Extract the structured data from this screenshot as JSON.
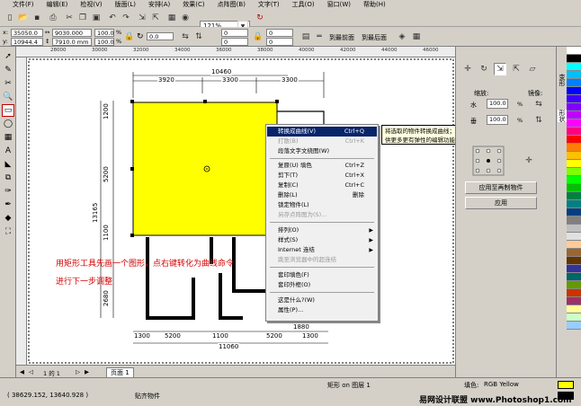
{
  "menubar": {
    "items": [
      "文件(F)",
      "编辑(E)",
      "检视(V)",
      "版面(L)",
      "安排(A)",
      "效果(C)",
      "点阵图(B)",
      "文字(T)",
      "工具(O)",
      "窗口(W)",
      "帮助(H)"
    ]
  },
  "toolbar": {
    "zoom_value": "121%"
  },
  "propbar": {
    "x_label": "x:",
    "x_value": "35050.0",
    "y_label": "y:",
    "y_value": "10944.4",
    "w_value": "9030.000 mr",
    "h_value": "7910.0 mm",
    "scale_w": "100.0",
    "scale_h": "100.0",
    "scale_unit": "%",
    "rotation": "0.0",
    "corner1": "0",
    "corner2": "0",
    "corner3": "0",
    "corner4": "0",
    "to_front": "到最前面",
    "to_back": "到最后面"
  },
  "ruler_top_ticks": [
    "28000",
    "30000",
    "32000",
    "34000",
    "36000",
    "38000",
    "40000",
    "42000",
    "44000",
    "46000",
    "48000"
  ],
  "ruler_left_ticks": [
    "24000",
    "22000",
    "20000",
    "18000",
    "16000",
    "14000",
    "12000"
  ],
  "drawing": {
    "dims_top_total": "10460",
    "dims_top": [
      "3920",
      "3300",
      "3300"
    ],
    "dims_left": [
      "1200",
      "5200",
      "1100",
      "4200",
      "2680"
    ],
    "dim_left_total": "13165",
    "dims_bottom": [
      "1300",
      "5200",
      "1100",
      "5200",
      "1300"
    ],
    "dim_bottom_total": "11060",
    "dim_small": "1880",
    "annotation_line1": "用矩形工具先画一个图形，点右键转化为曲线命令",
    "annotation_line2": "进行下一步调整",
    "fill_color": "#ffff00"
  },
  "context_menu": {
    "items": [
      {
        "label": "转换成曲线(V)",
        "shortcut": "Ctrl+Q",
        "state": "highlight"
      },
      {
        "label": "打散(B)",
        "shortcut": "Ctrl+K",
        "state": "disabled"
      },
      {
        "label": "段落文字文绕图(W)",
        "shortcut": "",
        "state": "normal"
      },
      {
        "label": "复原(U) 填色",
        "shortcut": "Ctrl+Z",
        "state": "normal"
      },
      {
        "label": "剪下(T)",
        "shortcut": "Ctrl+X",
        "state": "normal"
      },
      {
        "label": "复制(C)",
        "shortcut": "Ctrl+C",
        "state": "normal"
      },
      {
        "label": "删除(L)",
        "shortcut": "删除",
        "state": "normal"
      },
      {
        "label": "锁定物件(L)",
        "shortcut": "",
        "state": "normal"
      },
      {
        "label": "另存点阵图为(S)...",
        "shortcut": "",
        "state": "disabled"
      },
      {
        "label": "排列(O)",
        "shortcut": "",
        "state": "submenu"
      },
      {
        "label": "样式(S)",
        "shortcut": "",
        "state": "submenu"
      },
      {
        "label": "Internet 连结",
        "shortcut": "",
        "state": "submenu"
      },
      {
        "label": "跳至浏览器中的超连结",
        "shortcut": "",
        "state": "disabled"
      },
      {
        "label": "套印填色(F)",
        "shortcut": "",
        "state": "normal"
      },
      {
        "label": "套印外框(O)",
        "shortcut": "",
        "state": "normal"
      },
      {
        "label": "这是什么?(W)",
        "shortcut": "",
        "state": "normal"
      },
      {
        "label": "属性(P)...",
        "shortcut": "",
        "state": "normal"
      }
    ]
  },
  "tooltip": {
    "line1": "将选取的物件转换成曲线；「转换成曲线」可提",
    "line2": "供更多更有弹性的编辑功能"
  },
  "right_panel": {
    "scale_label": "缩放:",
    "mirror_label": "镜像:",
    "h_label": "水",
    "v_label": "垂",
    "h_value": "100.0",
    "v_value": "100.0",
    "unit": "%",
    "apply_copy": "应用至再制物件",
    "apply": "应用"
  },
  "docker_tabs": [
    "变形",
    "形状"
  ],
  "page_tabs": {
    "page_count": "1 的 1",
    "page_name": "页面 1"
  },
  "status": {
    "coords": "( 38629.152, 13640.928 )",
    "snap": "贴齐物件",
    "object_info": "矩形 on 图层 1",
    "fill_label": "填色:",
    "fill_value": "RGB Yellow",
    "watermark": "易网设计联盟 www.Photoshop1.com"
  },
  "palette_colors": [
    "#ffffff",
    "#000000",
    "#00ffff",
    "#00bfff",
    "#0080ff",
    "#0000ff",
    "#4000ff",
    "#8000ff",
    "#c000ff",
    "#ff00ff",
    "#ff0080",
    "#ff0000",
    "#ff8000",
    "#ffc000",
    "#ffff00",
    "#80ff00",
    "#00ff00",
    "#00c000",
    "#008040",
    "#008080",
    "#004080",
    "#808080",
    "#c0c0c0",
    "#e0e0e0",
    "#ffcc99",
    "#996633",
    "#663300",
    "#333399",
    "#006666",
    "#669900",
    "#cc3300",
    "#993366",
    "#ffff99",
    "#ccffcc",
    "#99ccff"
  ]
}
